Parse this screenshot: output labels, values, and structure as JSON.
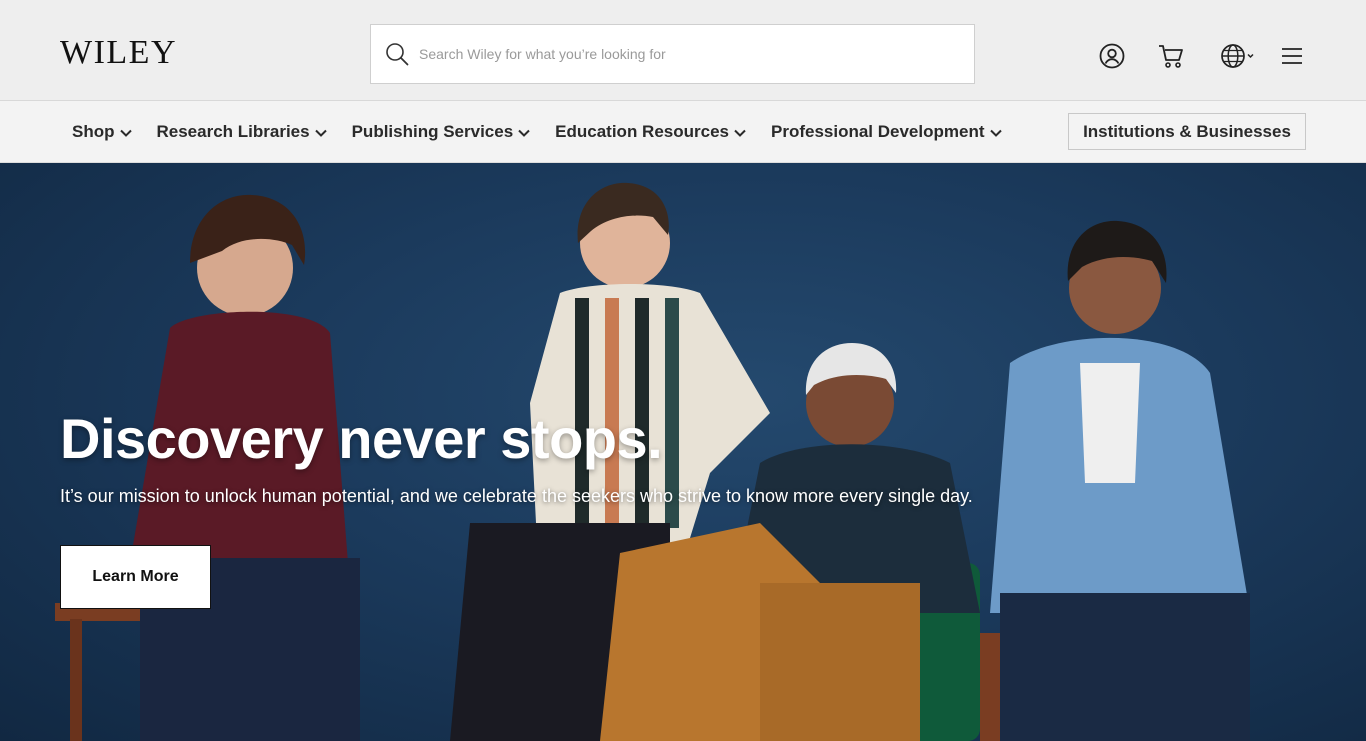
{
  "header": {
    "logo_text": "WILEY",
    "search": {
      "placeholder": "Search Wiley for what you’re looking for",
      "value": ""
    },
    "icons": [
      "user-account-icon",
      "shopping-cart-icon",
      "globe-language-icon",
      "hamburger-menu-icon"
    ]
  },
  "nav": {
    "items": [
      {
        "label": "Shop"
      },
      {
        "label": "Research Libraries"
      },
      {
        "label": "Publishing Services"
      },
      {
        "label": "Education Resources"
      },
      {
        "label": "Professional Development"
      }
    ],
    "institutions_label": "Institutions & Businesses"
  },
  "hero": {
    "title": "Discovery never stops.",
    "subtitle": "It’s our mission to unlock human potential, and we celebrate the seekers who strive to know more every single day.",
    "cta_label": "Learn More"
  },
  "colors": {
    "topbar_bg": "#eeeeee",
    "navbar_bg": "#f3f3f3",
    "hero_bg": "#1b3a5c",
    "cta_bg": "#ffffff"
  }
}
